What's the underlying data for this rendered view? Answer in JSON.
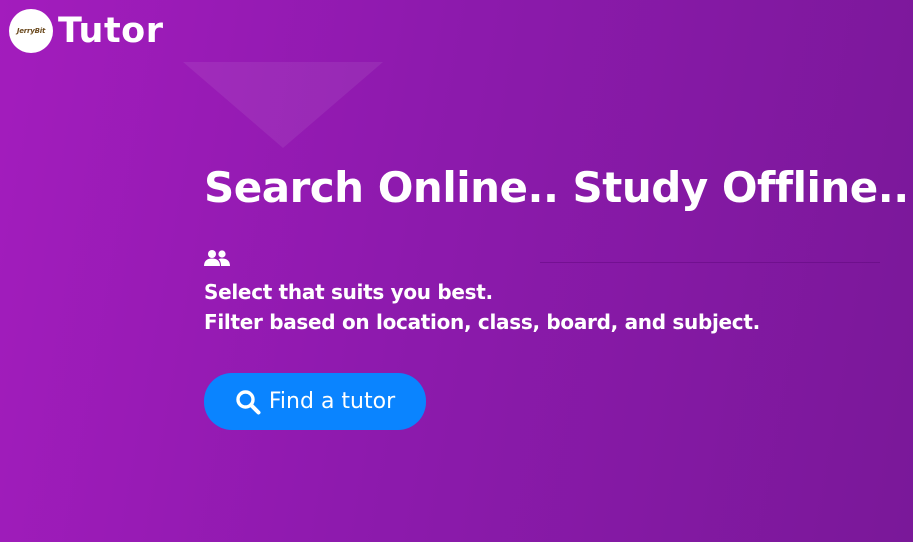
{
  "header": {
    "logo_badge_text": "JerryBit",
    "logo_text": "Tutor"
  },
  "hero": {
    "headline": "Search Online.. Study Offline..",
    "icon": "users-icon",
    "line1": "Select that suits you best.",
    "line2": "Filter based on location, class, board, and subject.",
    "button": {
      "label": "Find a tutor",
      "icon": "search-icon"
    }
  },
  "colors": {
    "background_start": "#a31cbd",
    "background_end": "#7a1899",
    "button": "#0a84ff",
    "text": "#ffffff"
  }
}
